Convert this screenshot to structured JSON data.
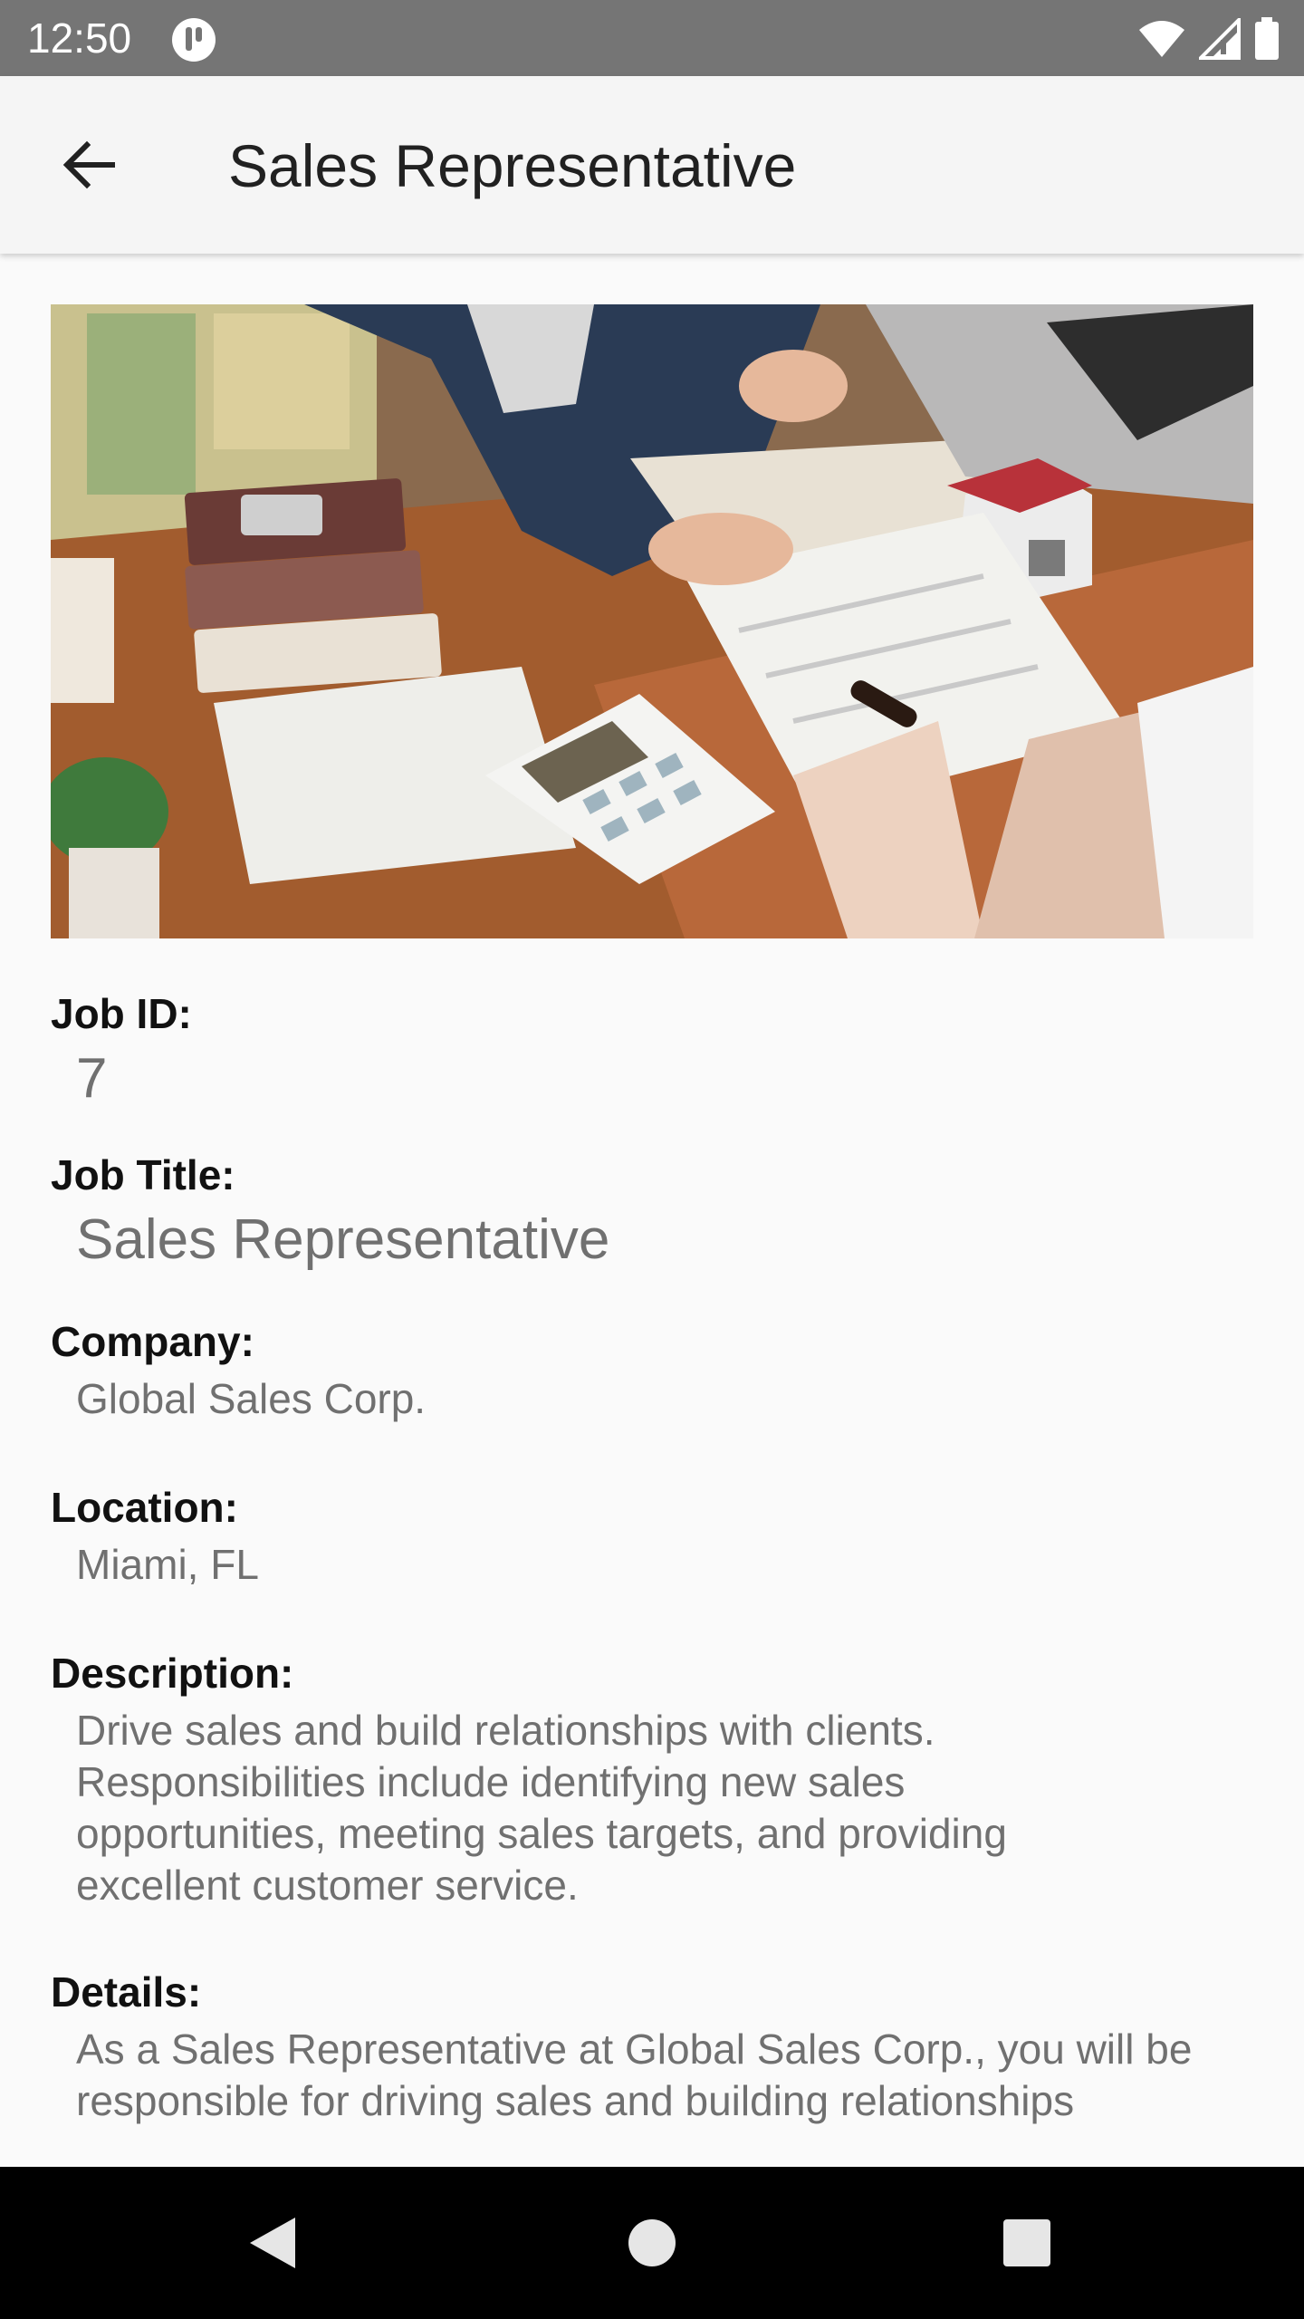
{
  "status_bar": {
    "time": "12:50",
    "icons": [
      "app-notification-icon",
      "wifi-icon",
      "cellular-signal-icon",
      "battery-icon"
    ]
  },
  "app_bar": {
    "title": "Sales Representative",
    "back_icon": "arrow-back-icon"
  },
  "hero_image": {
    "subject": "photo-business-meeting-calculator-house-model"
  },
  "job": {
    "id_label": "Job ID:",
    "id_value": "7",
    "title_label": "Job Title:",
    "title_value": "Sales Representative",
    "company_label": "Company:",
    "company_value": "Global Sales Corp.",
    "location_label": "Location:",
    "location_value": "Miami, FL",
    "description_label": "Description:",
    "description_value": "Drive sales and build relationships with clients. Responsibilities include identifying new sales opportunities, meeting sales targets, and providing excellent customer service.",
    "details_label": "Details:",
    "details_value": "As a Sales Representative at Global Sales Corp., you will be responsible for driving sales and building relationships"
  },
  "nav_bar": {
    "icons": [
      "nav-back-icon",
      "nav-home-icon",
      "nav-recents-icon"
    ]
  },
  "colors": {
    "status_bar": "#757575",
    "app_bar": "#f5f5f5",
    "background": "#fafafa",
    "label": "#111111",
    "value": "#707070",
    "nav_bar": "#000000"
  }
}
